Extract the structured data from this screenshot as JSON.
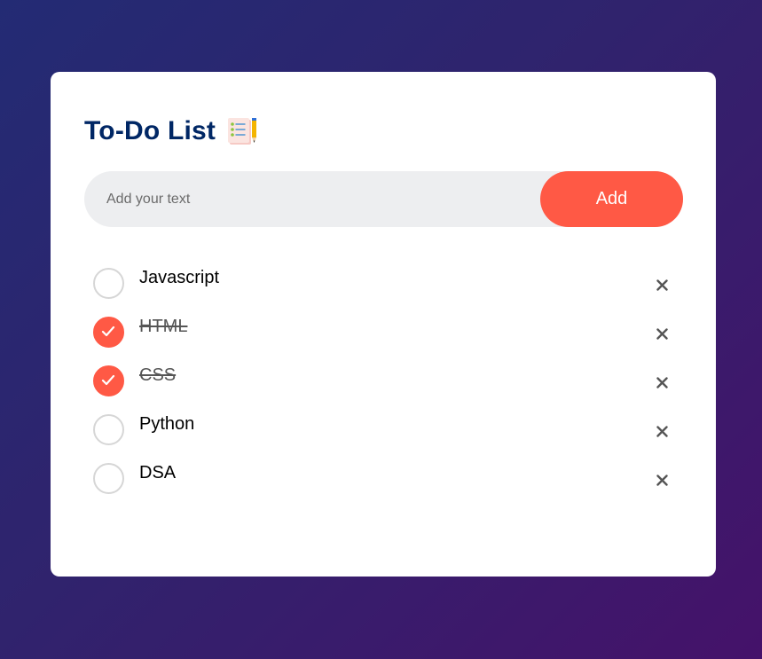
{
  "app": {
    "title": "To-Do List",
    "title_icon": "checklist-notepad-icon"
  },
  "input": {
    "placeholder": "Add your text",
    "value": "",
    "add_label": "Add"
  },
  "colors": {
    "accent": "#ff5945",
    "title": "#002765",
    "input_bg": "#edeef0"
  },
  "tasks": [
    {
      "text": "Javascript",
      "done": false
    },
    {
      "text": "HTML",
      "done": true
    },
    {
      "text": "CSS",
      "done": true
    },
    {
      "text": "Python",
      "done": false
    },
    {
      "text": "DSA",
      "done": false
    }
  ]
}
